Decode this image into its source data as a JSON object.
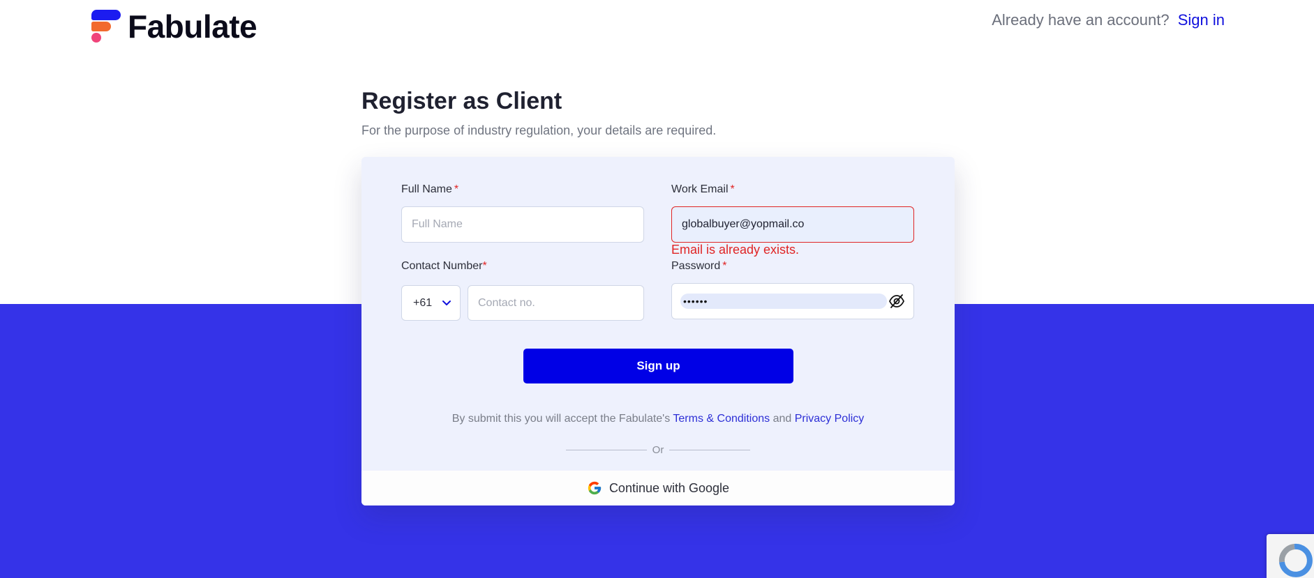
{
  "header": {
    "logo_text": "Fabulate",
    "account_prompt": "Already have an account?",
    "signin_label": "Sign in"
  },
  "page": {
    "title": "Register as Client",
    "subtitle": "For the purpose of industry regulation, your details are required."
  },
  "form": {
    "full_name": {
      "label": "Full Name",
      "required": "*",
      "placeholder": "Full Name",
      "value": ""
    },
    "work_email": {
      "label": "Work Email",
      "required": "*",
      "value": "globalbuyer@yopmail.co",
      "error": "Email is already exists."
    },
    "contact": {
      "label": "Contact Number",
      "required": "*",
      "country_code": "+61",
      "placeholder": "Contact no."
    },
    "password": {
      "label": "Password",
      "required": "*",
      "masked_value": "••••••"
    },
    "signup_label": "Sign up",
    "terms": {
      "prefix": "By submit this you will accept the Fabulate's",
      "terms_link": "Terms & Conditions",
      "joiner": "and",
      "privacy_link": "Privacy Policy"
    },
    "or_label": "Or",
    "google_label": "Continue with Google"
  },
  "colors": {
    "brand_blue": "#0000e6",
    "band_blue": "#3533e8",
    "error_red": "#e02424",
    "card_bg": "#eef1fd"
  }
}
